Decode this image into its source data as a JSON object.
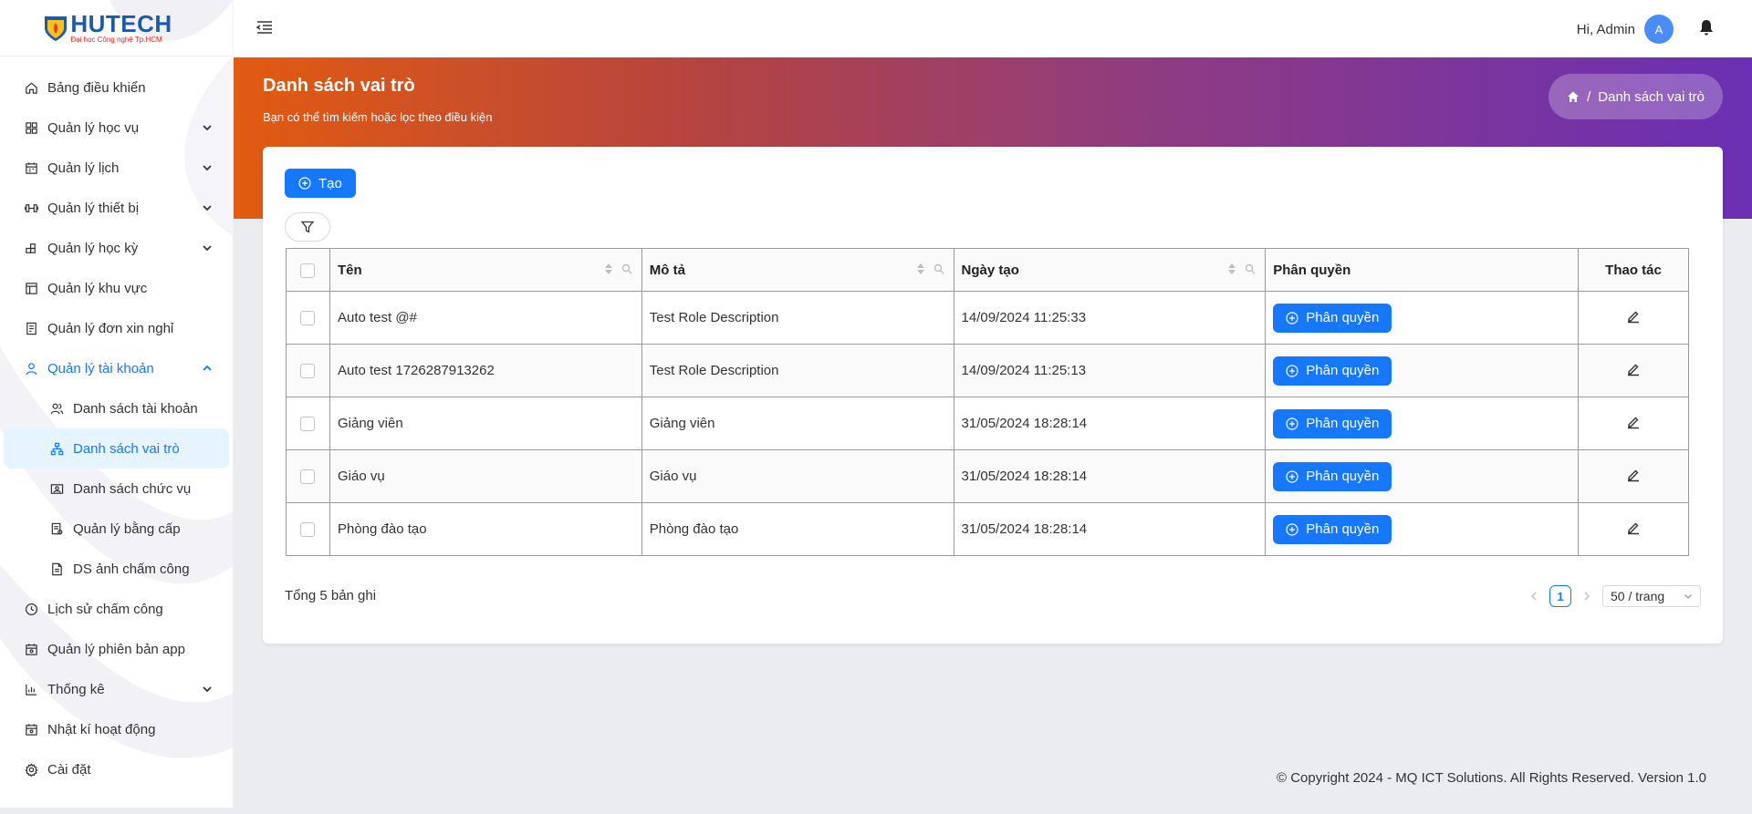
{
  "brand": {
    "name": "HUTECH",
    "subtitle": "Đại học Công nghệ Tp.HCM"
  },
  "header": {
    "greeting": "Hi, Admin",
    "avatar_letter": "A"
  },
  "sidebar": {
    "items": [
      {
        "label": "Bảng điều khiển"
      },
      {
        "label": "Quản lý học vụ"
      },
      {
        "label": "Quản lý lịch"
      },
      {
        "label": "Quản lý thiết bị"
      },
      {
        "label": "Quản lý học kỳ"
      },
      {
        "label": "Quản lý khu vực"
      },
      {
        "label": "Quản lý đơn xin nghỉ"
      },
      {
        "label": "Quản lý tài khoản"
      },
      {
        "label": "Lịch sử chấm công"
      },
      {
        "label": "Quản lý phiên bản app"
      },
      {
        "label": "Thống kê"
      },
      {
        "label": "Nhật kí hoạt động"
      },
      {
        "label": "Cài đặt"
      }
    ],
    "sub_items": [
      {
        "label": "Danh sách tài khoản"
      },
      {
        "label": "Danh sách vai trò"
      },
      {
        "label": "Danh sách chức vụ"
      },
      {
        "label": "Quản lý bằng cấp"
      },
      {
        "label": "DS ảnh chấm công"
      }
    ]
  },
  "banner": {
    "title": "Danh sách vai trò",
    "subtitle": "Bạn có thể tìm kiếm hoặc lọc theo điều kiện",
    "breadcrumb": "Danh sách vai trò"
  },
  "toolbar": {
    "create_label": "Tạo"
  },
  "table": {
    "columns": [
      "Tên",
      "Mô tả",
      "Ngày tạo",
      "Phân quyền",
      "Thao tác"
    ],
    "permission_label": "Phân quyền",
    "rows": [
      {
        "name": "Auto test @#",
        "description": "Test Role Description",
        "created": "14/09/2024 11:25:33"
      },
      {
        "name": "Auto test 1726287913262",
        "description": "Test Role Description",
        "created": "14/09/2024 11:25:13"
      },
      {
        "name": "Giảng viên",
        "description": "Giảng viên",
        "created": "31/05/2024 18:28:14"
      },
      {
        "name": "Giáo vụ",
        "description": "Giáo vụ",
        "created": "31/05/2024 18:28:14"
      },
      {
        "name": "Phòng đào tạo",
        "description": "Phòng đào tạo",
        "created": "31/05/2024 18:28:14"
      }
    ]
  },
  "pagination": {
    "total": "Tổng 5 bản ghi",
    "current_page": "1",
    "page_size": "50 / trang"
  },
  "footer": {
    "copyright": "© Copyright 2024 - MQ ICT Solutions. All Rights Reserved. Version 1.0"
  },
  "colors": {
    "primary": "#1677ff",
    "banner_start": "#e25b10",
    "banner_end": "#6a2fb4",
    "brand_blue": "#1f5aa8"
  }
}
